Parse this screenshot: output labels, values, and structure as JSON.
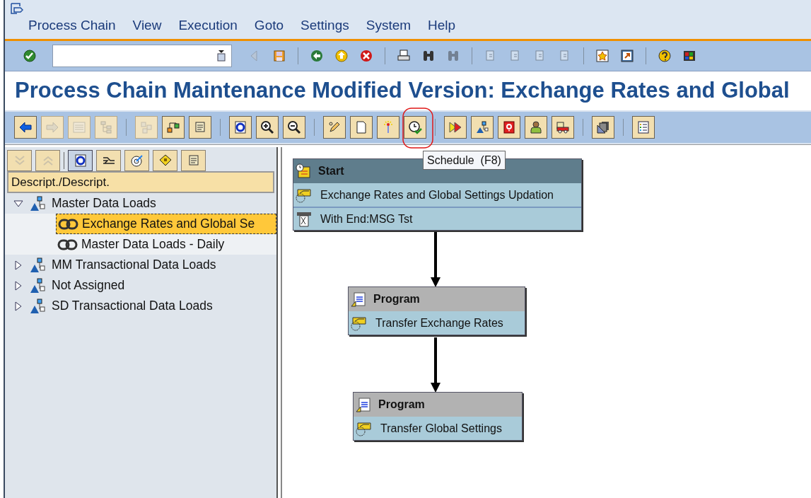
{
  "menu": [
    "Process Chain",
    "View",
    "Execution",
    "Goto",
    "Settings",
    "System",
    "Help"
  ],
  "system_toolbar": [
    {
      "kind": "button",
      "disabled": false
    },
    {
      "kind": "field"
    },
    {
      "kind": "button",
      "disabled": true
    },
    {
      "kind": "button",
      "disabled": false
    },
    {
      "kind": "separator"
    },
    {
      "kind": "button",
      "disabled": false
    },
    {
      "kind": "button",
      "disabled": false
    },
    {
      "kind": "button",
      "disabled": false
    },
    {
      "kind": "separator"
    },
    {
      "kind": "button",
      "disabled": false
    },
    {
      "kind": "button",
      "disabled": false
    },
    {
      "kind": "button",
      "disabled": true
    },
    {
      "kind": "separator"
    },
    {
      "kind": "button",
      "disabled": true
    },
    {
      "kind": "button",
      "disabled": true
    },
    {
      "kind": "button",
      "disabled": true
    },
    {
      "kind": "button",
      "disabled": true
    },
    {
      "kind": "separator"
    },
    {
      "kind": "button",
      "disabled": false
    },
    {
      "kind": "button",
      "disabled": false
    },
    {
      "kind": "separator"
    },
    {
      "kind": "button",
      "disabled": false
    },
    {
      "kind": "button",
      "disabled": false
    }
  ],
  "title": "Process Chain Maintenance Modified Version: Exchange Rates and Global",
  "application_toolbar": [
    {
      "kind": "button",
      "disabled": false
    },
    {
      "kind": "button",
      "disabled": true
    },
    {
      "kind": "button",
      "disabled": true
    },
    {
      "kind": "button",
      "disabled": true
    },
    {
      "kind": "separator"
    },
    {
      "kind": "button",
      "disabled": true
    },
    {
      "kind": "button",
      "disabled": false
    },
    {
      "kind": "button",
      "disabled": false
    },
    {
      "kind": "separator"
    },
    {
      "kind": "button",
      "disabled": false
    },
    {
      "kind": "button",
      "disabled": false
    },
    {
      "kind": "button",
      "disabled": false
    },
    {
      "kind": "separator"
    },
    {
      "kind": "button",
      "disabled": false
    },
    {
      "kind": "button",
      "disabled": false
    },
    {
      "kind": "button",
      "disabled": false
    },
    {
      "kind": "button",
      "disabled": false
    },
    {
      "kind": "separator"
    },
    {
      "kind": "button",
      "disabled": false
    },
    {
      "kind": "button",
      "disabled": false
    },
    {
      "kind": "button",
      "disabled": false
    },
    {
      "kind": "button",
      "disabled": false
    },
    {
      "kind": "button",
      "disabled": false
    },
    {
      "kind": "separator"
    },
    {
      "kind": "button",
      "disabled": false
    },
    {
      "kind": "separator"
    },
    {
      "kind": "button",
      "disabled": false
    }
  ],
  "tooltip": "Schedule  (F8)",
  "tree_toolbar": [
    {
      "kind": "button",
      "disabled": true,
      "selected": false
    },
    {
      "kind": "button",
      "disabled": true,
      "selected": false
    },
    {
      "kind": "separator"
    },
    {
      "kind": "button",
      "disabled": false,
      "selected": true
    },
    {
      "kind": "button",
      "disabled": false,
      "selected": false
    },
    {
      "kind": "button",
      "disabled": false,
      "selected": false
    },
    {
      "kind": "button",
      "disabled": false,
      "selected": false
    },
    {
      "kind": "button",
      "disabled": false,
      "selected": false
    }
  ],
  "tree_header": "Descript./Descript.",
  "tree": [
    {
      "label": "Master Data Loads",
      "expanded": true,
      "selected": false,
      "children": [
        {
          "label": "Exchange Rates and Global Se",
          "selected": true
        },
        {
          "label": "Master Data Loads - Daily",
          "selected": false
        }
      ]
    },
    {
      "label": "MM Transactional Data Loads",
      "expanded": false,
      "selected": false
    },
    {
      "label": "Not Assigned",
      "expanded": false,
      "selected": false
    },
    {
      "label": "SD Transactional Data Loads",
      "expanded": false,
      "selected": false
    }
  ],
  "chain": [
    {
      "kind": "start",
      "title": "Start",
      "rows": [
        {
          "kind": "variant",
          "text": "Exchange Rates and Global Settings Updation"
        },
        {
          "kind": "end",
          "text": "With End:MSG Tst"
        }
      ]
    },
    {
      "kind": "program",
      "title": "Program",
      "rows": [
        {
          "kind": "variant",
          "text": "Transfer Exchange Rates"
        }
      ]
    },
    {
      "kind": "program",
      "title": "Program",
      "rows": [
        {
          "kind": "variant",
          "text": "Transfer Global Settings"
        }
      ]
    }
  ]
}
